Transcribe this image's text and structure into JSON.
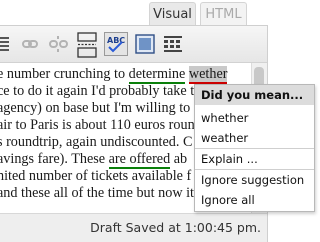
{
  "tabs": {
    "visual": "Visual",
    "html": "HTML"
  },
  "toolbar": {
    "icons": [
      "indent-icon",
      "link-icon",
      "unlink-icon",
      "more-tag-icon",
      "spellcheck-icon",
      "fullscreen-icon",
      "kitchen-sink-icon"
    ]
  },
  "content": {
    "l1_a": "e number crunching to ",
    "l1_b": "determine",
    "l1_c": " ",
    "l1_d": "wether",
    "l2": "ce to do it again I'd probably take t",
    "l3": "agency) on base but I'm willing to",
    "l4": "air to Paris is about 110 euros round",
    "l5": "s roundtrip, again undiscounted. C",
    "l6_a": "avings fare). These ",
    "l6_b": "are offered",
    "l6_c": " ab",
    "l7": "nited number of tickets available f",
    "l8": "and these all of the time but now it seems"
  },
  "status": "Draft Saved at 1:00:45 pm.",
  "menu": {
    "header": "Did you mean...",
    "suggestions": [
      "whether",
      "weather"
    ],
    "explain": "Explain ...",
    "ignore": "Ignore suggestion",
    "ignore_all": "Ignore all"
  }
}
